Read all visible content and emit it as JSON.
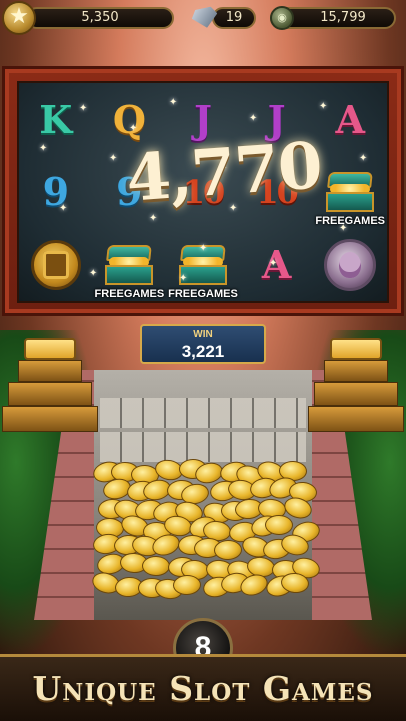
{
  "hud": {
    "xp_value": "5,350",
    "gems_value": "19",
    "coins_value": "15,799",
    "icons": [
      "star-icon",
      "gem-icon",
      "coin-icon"
    ]
  },
  "slot": {
    "grid": [
      [
        "K",
        "Q",
        "J",
        "J",
        "A"
      ],
      [
        "9",
        "9",
        "10",
        "10",
        "FREEGAMES"
      ],
      [
        "mask",
        "FREEGAMES",
        "FREEGAMES",
        "A",
        "goddess"
      ]
    ],
    "big_win": "4,770",
    "free_games_label": "FREEGAMES"
  },
  "win_panel": {
    "label": "WIN",
    "value": "3,221"
  },
  "counter": {
    "value": "8"
  },
  "banner": {
    "title": "Unique Slot Games"
  },
  "colors": {
    "frame": "#8b2b16",
    "gold": "#e8b52a",
    "banner_text": "#f5e3b7"
  }
}
